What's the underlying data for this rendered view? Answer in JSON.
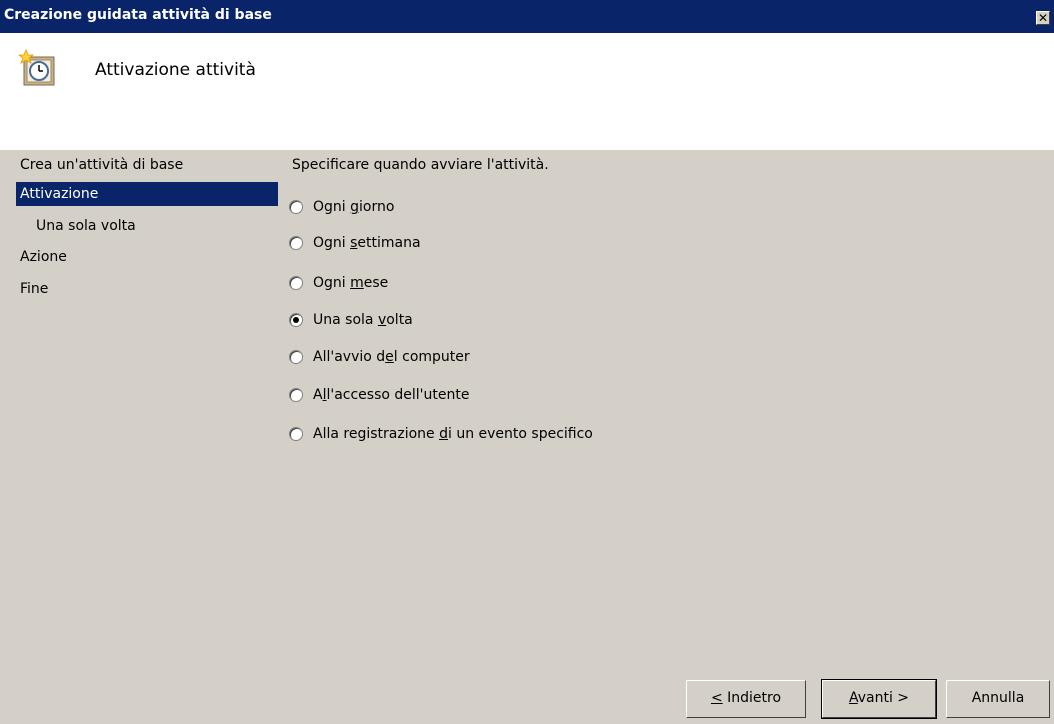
{
  "window": {
    "title": "Creazione guidata attività di base",
    "close_glyph": "✕"
  },
  "header": {
    "icon": "clock-schedule-icon",
    "title": "Attivazione attività"
  },
  "steps": [
    {
      "label": "Crea un'attività di base",
      "active": false
    },
    {
      "label": "Attivazione",
      "active": true
    },
    {
      "label": "Una sola volta",
      "active": false
    },
    {
      "label": "Azione",
      "active": false
    },
    {
      "label": "Fine",
      "active": false
    }
  ],
  "content": {
    "instruction": "Specificare quando avviare l'attività.",
    "options": [
      {
        "before": "Ogni ",
        "mnemonic": "g",
        "after": "iorno",
        "checked": false
      },
      {
        "before": "Ogni ",
        "mnemonic": "s",
        "after": "ettimana",
        "checked": false
      },
      {
        "before": "Ogni ",
        "mnemonic": "m",
        "after": "ese",
        "checked": false
      },
      {
        "before": "Una sola ",
        "mnemonic": "v",
        "after": "olta",
        "checked": true
      },
      {
        "before": "All'avvio d",
        "mnemonic": "e",
        "after": "l computer",
        "checked": false
      },
      {
        "before": "A",
        "mnemonic": "l",
        "after": "l'accesso dell'utente",
        "checked": false
      },
      {
        "before": "Alla registrazione ",
        "mnemonic": "d",
        "after": "i un evento specifico",
        "checked": false
      }
    ]
  },
  "buttons": {
    "back": {
      "mnemonic": "<",
      "after": " Indietro"
    },
    "next": {
      "mnemonic": "A",
      "after": "vanti >"
    },
    "cancel": {
      "label": "Annulla"
    }
  }
}
